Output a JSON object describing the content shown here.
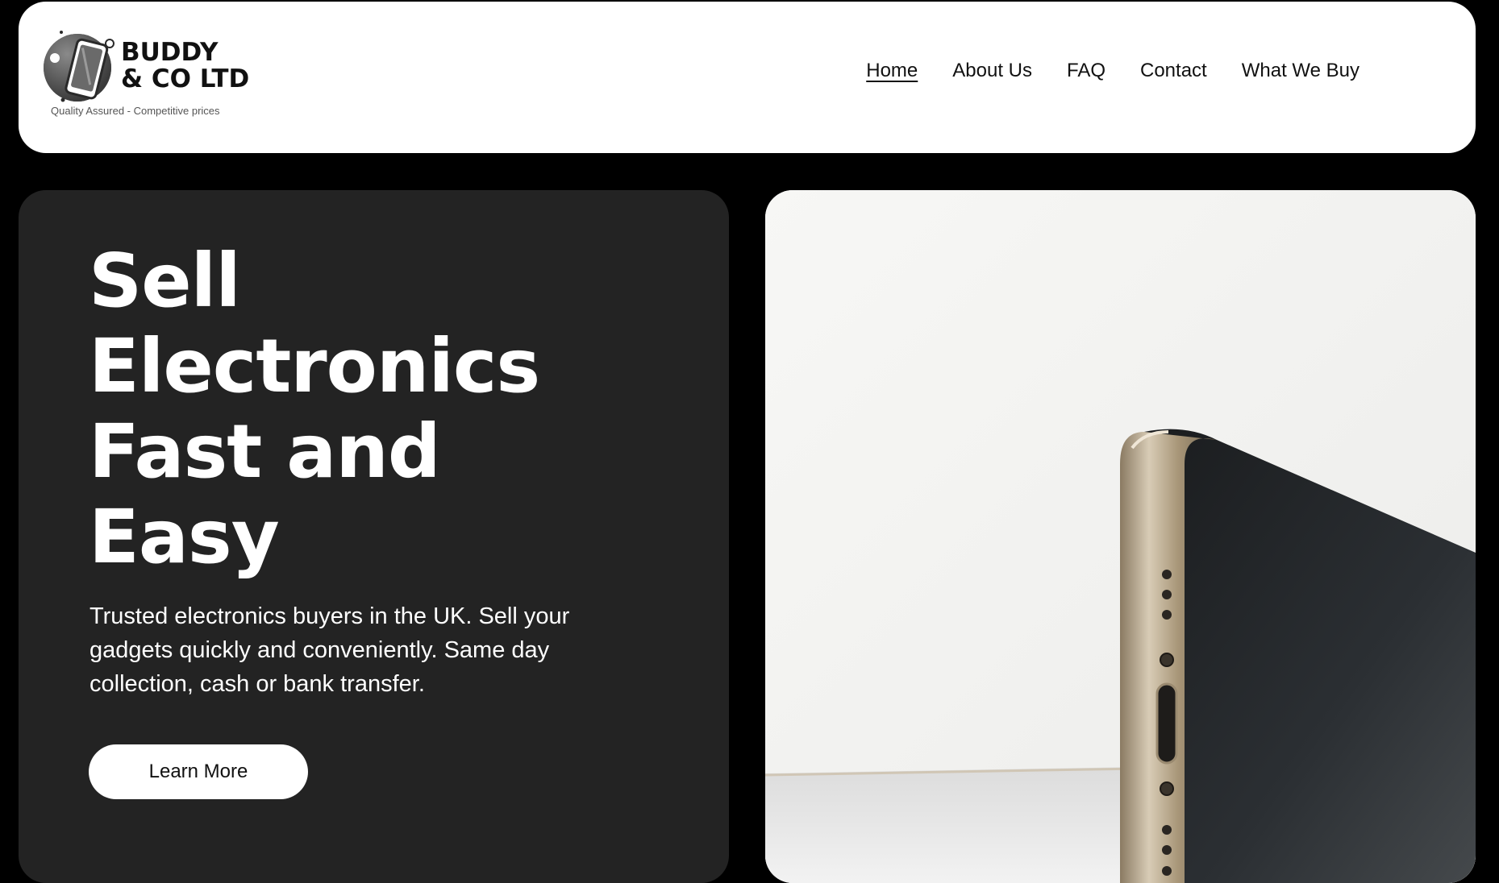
{
  "brand": {
    "name_line1": "BUDDY",
    "name_line2": "& CO LTD",
    "tagline": "Quality Assured - Competitive prices"
  },
  "nav": {
    "items": [
      {
        "label": "Home",
        "active": true
      },
      {
        "label": "About Us",
        "active": false
      },
      {
        "label": "FAQ",
        "active": false
      },
      {
        "label": "Contact",
        "active": false
      },
      {
        "label": "What We Buy",
        "active": false
      }
    ]
  },
  "hero": {
    "title_lines": [
      "Sell",
      "Electronics",
      "Fast and",
      "Easy"
    ],
    "description": "Trusted electronics buyers in the UK. Sell your gadgets quickly and conveniently. Same day collection, cash or bank transfer.",
    "button_label": "Learn More"
  },
  "colors": {
    "page_background": "#000000",
    "header_background": "#ffffff",
    "hero_panel": "#232323",
    "button_background": "#ffffff",
    "text_dark": "#111111",
    "text_light": "#ffffff"
  },
  "icons": {
    "logo": "phone-in-circle-logo-icon"
  }
}
